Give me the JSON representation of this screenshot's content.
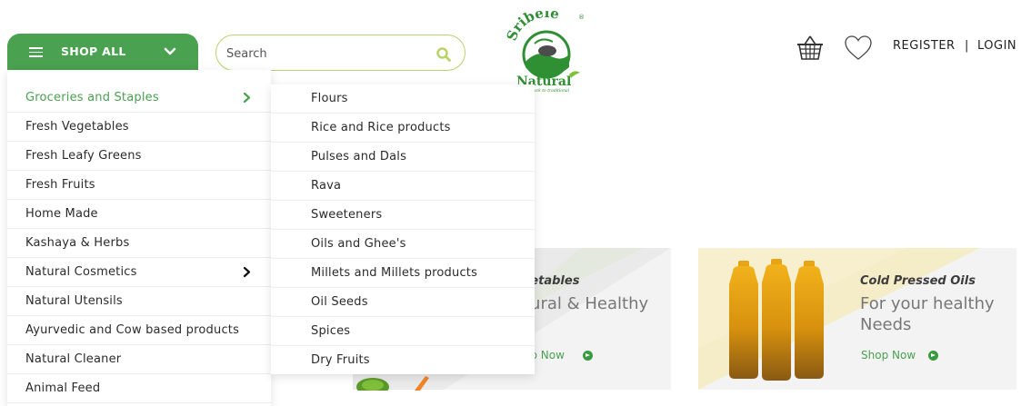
{
  "header": {
    "shop_all_label": "SHOP ALL",
    "search_placeholder": "Search",
    "register_label": "REGISTER",
    "separator": "|",
    "login_label": "LOGIN",
    "logo": {
      "top_text": "Sribele",
      "bottom_text": "Natural",
      "tagline": "back to traditional",
      "registered_mark": "®"
    }
  },
  "menu": {
    "items": [
      {
        "label": "Groceries and Staples",
        "active": true,
        "has_submenu": true
      },
      {
        "label": "Fresh Vegetables"
      },
      {
        "label": "Fresh Leafy Greens"
      },
      {
        "label": "Fresh Fruits"
      },
      {
        "label": "Home Made"
      },
      {
        "label": "Kashaya & Herbs"
      },
      {
        "label": "Natural Cosmetics",
        "has_submenu": true
      },
      {
        "label": "Natural Utensils"
      },
      {
        "label": "Ayurvedic and Cow based products"
      },
      {
        "label": "Natural Cleaner"
      },
      {
        "label": "Animal Feed"
      }
    ]
  },
  "submenu": {
    "items": [
      "Flours",
      "Rice and Rice products",
      "Pulses and Dals",
      "Rava",
      "Sweeteners",
      "Oils and Ghee's",
      "Millets and Millets products",
      "Oil Seeds",
      "Spices",
      "Dry Fruits"
    ]
  },
  "promo": {
    "card1": {
      "category": "getables",
      "tagline": "tural & Healthy",
      "cta": "op Now"
    },
    "card2": {
      "category": "Cold Pressed Oils",
      "tagline_line1": "For your healthy",
      "tagline_line2": "Needs",
      "cta": "Shop Now"
    }
  },
  "colors": {
    "brand_green": "#4aa14f",
    "search_border": "#b7d36a",
    "menu_active": "#4aa14f"
  },
  "icons": [
    "hamburger-icon",
    "chevron-down-icon",
    "search-icon",
    "basket-icon",
    "heart-icon",
    "chevron-right-icon",
    "arrow-circle-icon"
  ]
}
